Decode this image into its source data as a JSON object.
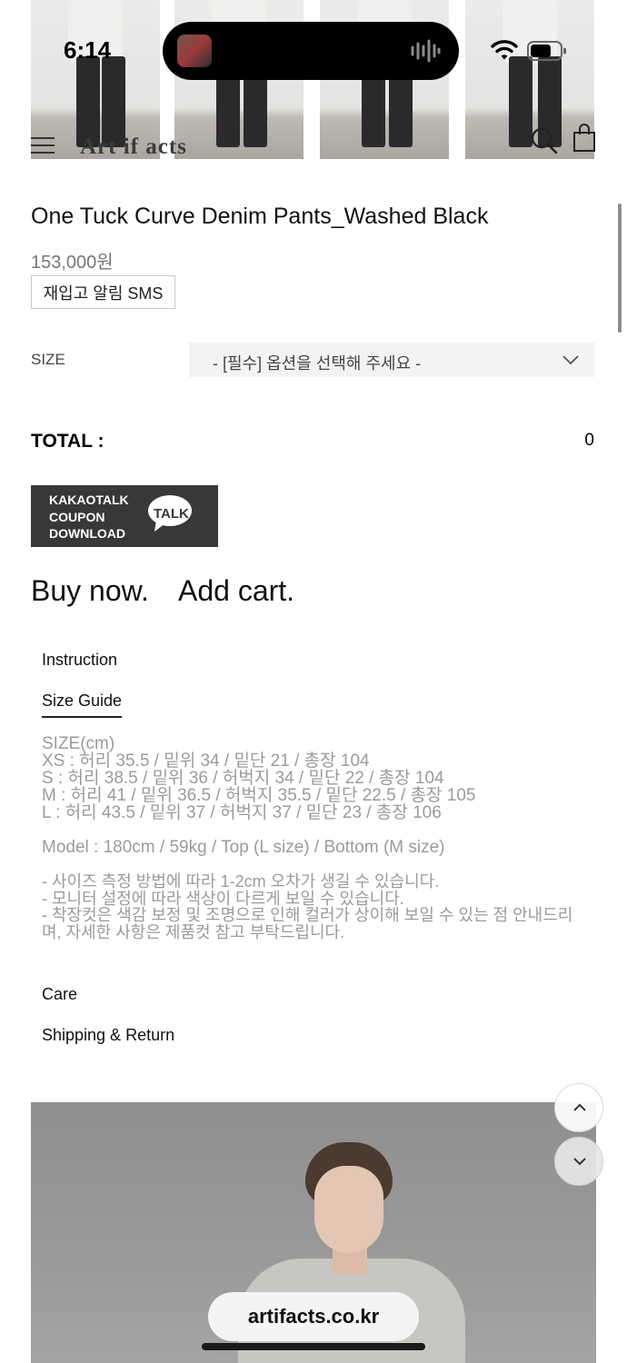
{
  "status_bar": {
    "time": "6:14"
  },
  "header": {
    "logo": "Art if acts"
  },
  "product": {
    "title": "One Tuck Curve Denim Pants_Washed Black",
    "price": "153,000원",
    "restock_button": "재입고 알림 SMS",
    "size_label": "SIZE",
    "size_placeholder": "- [필수] 옵션을 선택해 주세요 -",
    "total_label": "TOTAL :",
    "total_value": "0",
    "coupon_text": "KAKAOTALK\nCOUPON\nDOWNLOAD",
    "coupon_badge": "TALK",
    "buy_now": "Buy now.",
    "add_cart": "Add cart."
  },
  "tabs": {
    "instruction": "Instruction",
    "size_guide": "Size Guide",
    "care": "Care",
    "shipping": "Shipping & Return"
  },
  "size_guide": {
    "lines": [
      "SIZE(cm)",
      "XS : 허리 35.5 / 밑위 34 / 밑단 21 / 총장 104",
      "S : 허리 38.5 / 밑위 36 / 허벅지 34 / 밑단 22 / 총장 104",
      "M : 허리 41 / 밑위 36.5 / 허벅지 35.5 / 밑단 22.5 / 총장 105",
      "L : 허리 43.5 / 밑위 37 / 허벅지 37 / 밑단 23 / 총장 106"
    ],
    "model": "Model : 180cm / 59kg / Top (L size) / Bottom (M size)",
    "notes": [
      "- 사이즈 측정 방법에 따라 1-2cm 오차가 생길 수 있습니다.",
      "- 모니터 설정에 따라 색상이 다르게 보일 수 있습니다.",
      "- 착장컷은 색감 보정 및 조명으로 인해 컬러가 상이해 보일 수 있는 점 안내드리며, 자세한 사항은 제품컷 참고 부탁드립니다."
    ]
  },
  "browser": {
    "url": "artifacts.co.kr"
  }
}
